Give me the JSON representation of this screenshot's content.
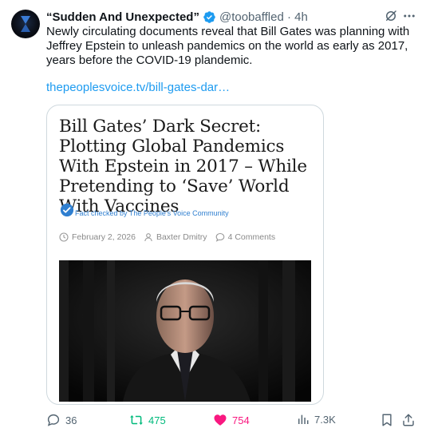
{
  "tweet": {
    "display_name": "“Sudden And Unexpected”",
    "handle": "@toobaffled · 4h",
    "text": "Newly circulating documents reveal that Bill Gates was planning with Jeffrey Epstein to unleash pandemics on the world as early as 2017, years before the COVID-19 plandemic.",
    "link": "thepeoplesvoice.tv/bill-gates-dar…"
  },
  "card": {
    "headline": "Bill Gates’ Dark Secret: Plotting Global Pandemics With Epstein in 2017 – While Pretending to ‘Save’ World With Vaccines",
    "fact_check": "Fact checked by The People's Voice Community",
    "date": "February 2, 2026",
    "author": "Baxter Dmitry",
    "comments": "4 Comments"
  },
  "actions": {
    "replies": "36",
    "reposts": "475",
    "likes": "754",
    "views": "7.3K"
  },
  "colors": {
    "accent": "#1d9bf0",
    "repost": "#00ba7c",
    "like": "#f91880",
    "muted": "#536471"
  },
  "icons": [
    "verified-badge-icon",
    "grok-icon",
    "more-icon",
    "fact-check-icon",
    "clock-icon",
    "user-icon",
    "comment-icon",
    "reply-icon",
    "repost-icon",
    "heart-icon",
    "views-icon",
    "bookmark-icon",
    "share-icon"
  ]
}
